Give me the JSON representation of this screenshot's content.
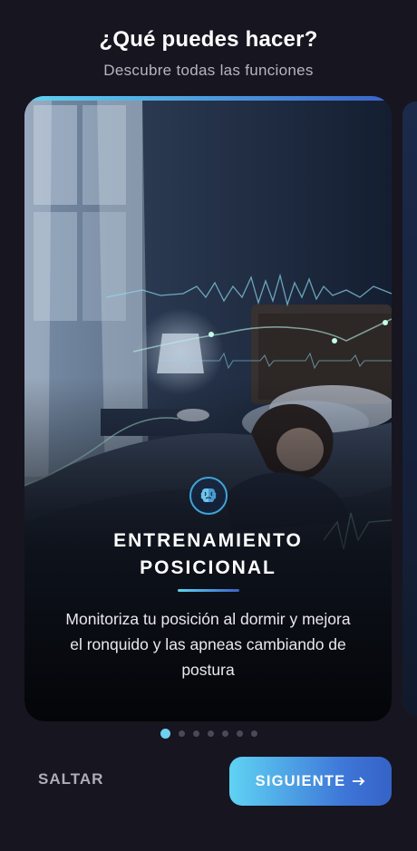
{
  "header": {
    "title": "¿Qué puedes hacer?",
    "subtitle": "Descubre todas las funciones"
  },
  "card": {
    "icon": "brain-icon",
    "title": "ENTRENAMIENTO POSICIONAL",
    "description": "Monitoriza tu posición al dormir y mejora el ronquido y las apneas cambiando de postura",
    "image": "woman-sleeping-in-bed-with-signal-waves"
  },
  "pagination": {
    "total": 7,
    "active": 1
  },
  "footer": {
    "skip_label": "SALTAR",
    "next_label": "SIGUIENTE",
    "next_icon": "arrow-right-icon"
  },
  "colors": {
    "background": "#17151f",
    "accent_start": "#5fd3f3",
    "accent_end": "#3562c6",
    "dot_inactive": "#4b4957"
  }
}
